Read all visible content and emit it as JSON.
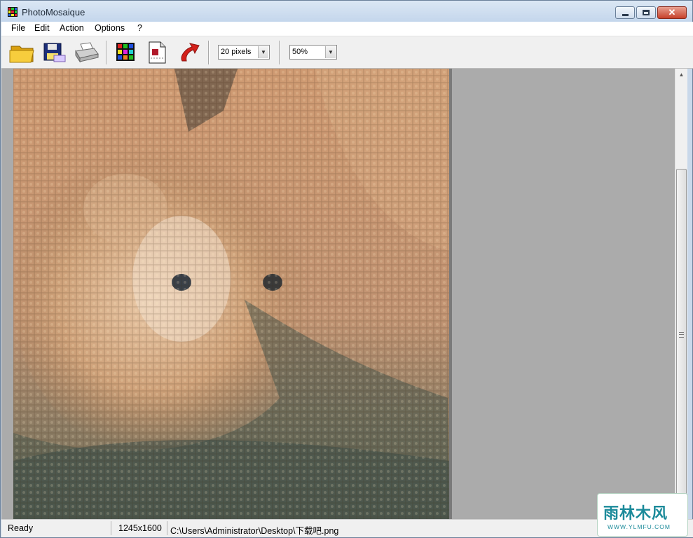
{
  "window": {
    "title": "PhotoMosaique"
  },
  "menu": {
    "items": [
      "File",
      "Edit",
      "Action",
      "Options",
      "?"
    ]
  },
  "toolbar": {
    "buttons": [
      "open-folder-icon",
      "save-disk-icon",
      "print-icon",
      "color-grid-icon",
      "document-icon",
      "undo-arrow-icon"
    ],
    "tile_size": "20 pixels",
    "zoom": "50%"
  },
  "status": {
    "state": "Ready",
    "dimensions": "1245x1600",
    "path": "C:\\Users\\Administrator\\Desktop\\下载吧.png"
  },
  "watermark": {
    "main": "雨林木风",
    "sub": "WWW.YLMFU.COM"
  },
  "colors": {
    "titlebar": "#c9d8ea",
    "workspace": "#ababab",
    "close": "#c7412b"
  }
}
